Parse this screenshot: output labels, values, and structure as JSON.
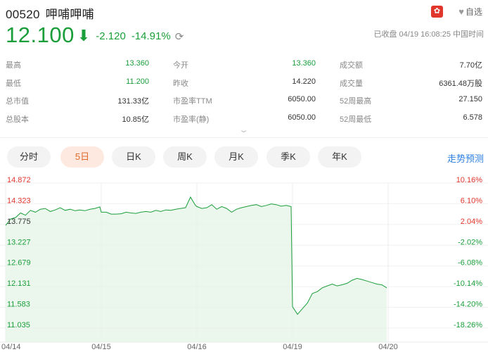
{
  "header": {
    "code": "00520",
    "name": "呷哺呷哺",
    "fav_label": "自选",
    "flag_icon": "hk-flag-icon"
  },
  "quote": {
    "price": "12.100",
    "change": "-2.120",
    "change_pct": "-14.91%",
    "status": "已收盘 04/19 16:08:25 中国时间",
    "color_down": "#1a9e3a"
  },
  "stats": [
    [
      {
        "label": "最高",
        "value": "13.360",
        "tone": "green"
      },
      {
        "label": "今开",
        "value": "13.360",
        "tone": "green"
      },
      {
        "label": "成交额",
        "value": "7.70亿",
        "tone": "dark"
      }
    ],
    [
      {
        "label": "最低",
        "value": "11.200",
        "tone": "green"
      },
      {
        "label": "昨收",
        "value": "14.220",
        "tone": "dark"
      },
      {
        "label": "成交量",
        "value": "6361.48万股",
        "tone": "dark"
      }
    ],
    [
      {
        "label": "总市值",
        "value": "131.33亿",
        "tone": "dark"
      },
      {
        "label": "市盈率TTM",
        "value": "6050.00",
        "tone": "dark"
      },
      {
        "label": "52周最高",
        "value": "27.150",
        "tone": "dark"
      }
    ],
    [
      {
        "label": "总股本",
        "value": "10.85亿",
        "tone": "dark"
      },
      {
        "label": "市盈率(静)",
        "value": "6050.00",
        "tone": "dark"
      },
      {
        "label": "52周最低",
        "value": "6.578",
        "tone": "dark"
      }
    ]
  ],
  "tabs": [
    "分时",
    "5日",
    "日K",
    "周K",
    "月K",
    "季K",
    "年K"
  ],
  "active_tab": "5日",
  "forecast_label": "走势预测",
  "chart_data": {
    "type": "area",
    "prev_close": 14.22,
    "ylim": [
      11.035,
      14.872
    ],
    "y_ticks": [
      "14.872",
      "14.323",
      "13.775",
      "13.227",
      "12.679",
      "12.131",
      "11.583",
      "11.035"
    ],
    "pct_ticks": [
      "10.16%",
      "6.10%",
      "2.04%",
      "-2.02%",
      "-6.08%",
      "-10.14%",
      "-14.20%",
      "-18.26%"
    ],
    "x_ticks": [
      "04/14",
      "04/15",
      "04/16",
      "04/19",
      "04/20"
    ],
    "colors": {
      "line": "#1a9e3a",
      "fill": "#e6f4e9",
      "up_label": "#e0362b",
      "down_label": "#1a9e3a",
      "mid_label": "#333333"
    },
    "series": [
      {
        "values": [
          13.75,
          13.92,
          13.96,
          14.08,
          14.02,
          14.15,
          14.1,
          14.18,
          14.2,
          14.12,
          14.16,
          14.22,
          14.15,
          14.18,
          14.14,
          14.16,
          14.14,
          14.18,
          14.2,
          14.24,
          14.1,
          14.1,
          14.05,
          14.05,
          14.06,
          14.1,
          14.08,
          14.07,
          14.1,
          14.12,
          14.1,
          14.15,
          14.12,
          14.16,
          14.15,
          14.18,
          14.2,
          14.22,
          14.5,
          14.28,
          14.25,
          14.2,
          14.22,
          14.3,
          14.18,
          14.25,
          14.2,
          14.1,
          14.18,
          14.22,
          14.25,
          14.28,
          14.3,
          14.25,
          14.28,
          14.32,
          14.3,
          14.26,
          14.28,
          14.25,
          11.6,
          11.4,
          11.55,
          11.7,
          11.95,
          12.0,
          12.1,
          12.15,
          12.2,
          12.15,
          12.18,
          12.22,
          12.3,
          12.35,
          12.32,
          12.28,
          12.24,
          12.2,
          12.18,
          12.1
        ]
      }
    ]
  }
}
